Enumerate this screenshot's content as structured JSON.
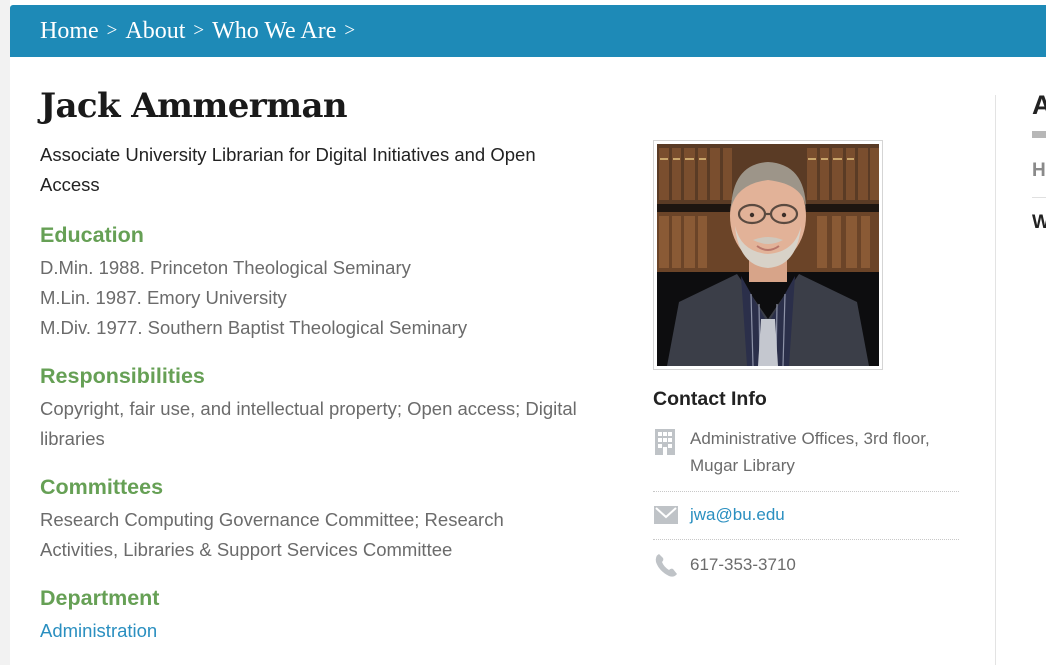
{
  "breadcrumb": {
    "items": [
      "Home",
      "About",
      "Who We Are"
    ],
    "separator": ">"
  },
  "profile": {
    "name": "Jack Ammerman",
    "title_line1": "Associate University Librarian for Digital Initiatives and Open",
    "title_line2": "Access"
  },
  "education": {
    "heading": "Education",
    "items": [
      "D.Min. 1988. Princeton Theological Seminary",
      "M.Lin. 1987. Emory University",
      "M.Div. 1977. Southern Baptist Theological Seminary"
    ]
  },
  "responsibilities": {
    "heading": "Responsibilities",
    "line1": "Copyright, fair use, and intellectual property; Open access; Digital",
    "line2": "libraries"
  },
  "committees": {
    "heading": "Committees",
    "line1": "Research Computing Governance Committee; Research",
    "line2": "Activities, Libraries & Support Services Committee"
  },
  "department": {
    "heading": "Department",
    "link": "Administration"
  },
  "contact": {
    "heading": "Contact Info",
    "address_line1": "Administrative Offices, 3rd floor,",
    "address_line2": "Mugar Library",
    "email": "jwa@bu.edu",
    "phone": "617-353-3710"
  },
  "sidebar": {
    "title_fragment": "A",
    "item1_fragment": "H",
    "item2_fragment": "W"
  },
  "colors": {
    "breadcrumb_bg": "#1e8ab7",
    "section_heading": "#66a055",
    "link": "#2a8fc0",
    "body_text": "#6b6b6b"
  }
}
